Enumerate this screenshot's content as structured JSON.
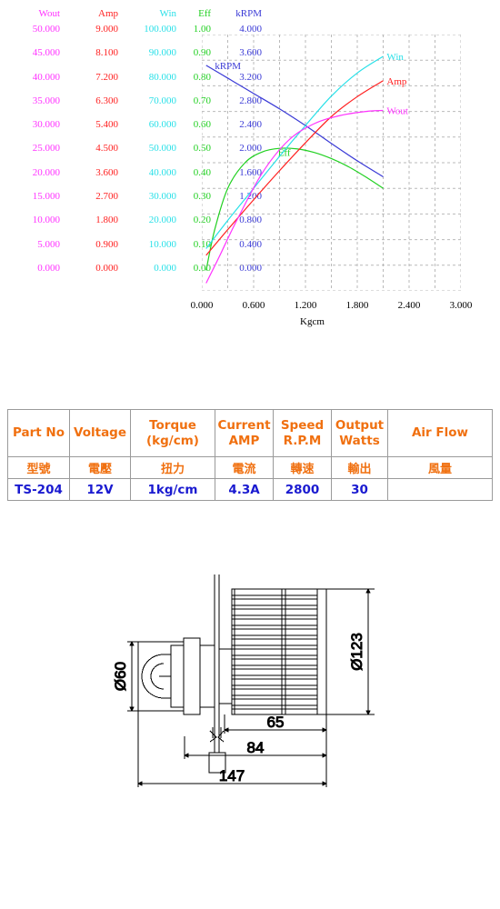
{
  "chart_data": {
    "type": "line",
    "title": "",
    "xlabel": "Kgcm",
    "ylabel": "",
    "xlim": [
      0.0,
      3.0
    ],
    "grid": true,
    "legend": "inline-labels",
    "xticks": [
      "0.000",
      "0.600",
      "1.200",
      "1.800",
      "2.400",
      "3.000"
    ],
    "axes": [
      {
        "name": "Wout",
        "color": "#ff33ff",
        "ticks": [
          "50.000",
          "45.000",
          "40.000",
          "35.000",
          "30.000",
          "25.000",
          "20.000",
          "15.000",
          "10.000",
          "5.000",
          "0.000"
        ],
        "ylim": [
          0,
          50
        ]
      },
      {
        "name": "Amp",
        "color": "#ff2020",
        "ticks": [
          "9.000",
          "8.100",
          "7.200",
          "6.300",
          "5.400",
          "4.500",
          "3.600",
          "2.700",
          "1.800",
          "0.900",
          "0.000"
        ],
        "ylim": [
          0,
          9
        ]
      },
      {
        "name": "Win",
        "color": "#29e0e8",
        "ticks": [
          "100.000",
          "90.000",
          "80.000",
          "70.000",
          "60.000",
          "50.000",
          "40.000",
          "30.000",
          "20.000",
          "10.000",
          "0.000"
        ],
        "ylim": [
          0,
          100
        ]
      },
      {
        "name": "Eff",
        "color": "#21d021",
        "ticks": [
          "1.00",
          "0.90",
          "0.80",
          "0.70",
          "0.60",
          "0.50",
          "0.40",
          "0.30",
          "0.20",
          "0.10",
          "0.00"
        ],
        "ylim": [
          0,
          1
        ]
      },
      {
        "name": "kRPM",
        "color": "#3a3ad6",
        "ticks": [
          "4.000",
          "3.600",
          "3.200",
          "2.800",
          "2.400",
          "2.000",
          "1.600",
          "1.200",
          "0.800",
          "0.400",
          "0.000"
        ],
        "ylim": [
          0,
          4
        ]
      }
    ],
    "series": [
      {
        "name": "kRPM",
        "color": "#3a3ad6",
        "unit": "kRPM",
        "label_at": {
          "x": 0.13,
          "y": 3.52
        },
        "x": [
          0.05,
          0.3,
          0.6,
          0.9,
          1.2,
          1.5,
          1.8,
          2.1
        ],
        "values": [
          3.52,
          3.32,
          3.08,
          2.84,
          2.58,
          2.3,
          2.03,
          1.78
        ]
      },
      {
        "name": "Eff",
        "color": "#21d021",
        "unit": "Eff",
        "label_at": {
          "x": 0.86,
          "y": 0.54
        },
        "x": [
          0.05,
          0.15,
          0.3,
          0.5,
          0.7,
          0.9,
          1.1,
          1.3,
          1.5,
          1.7,
          1.9,
          2.1
        ],
        "values": [
          0.08,
          0.24,
          0.4,
          0.5,
          0.542,
          0.556,
          0.554,
          0.54,
          0.516,
          0.484,
          0.444,
          0.4
        ]
      },
      {
        "name": "Win",
        "color": "#29e0e8",
        "unit": "Win",
        "label_at": {
          "x": 2.12,
          "y": 91.5
        },
        "x": [
          0.05,
          0.3,
          0.6,
          0.9,
          1.2,
          1.5,
          1.8,
          2.1
        ],
        "values": [
          16.5,
          27.5,
          40.0,
          52.5,
          64.5,
          76.0,
          85.0,
          91.5
        ]
      },
      {
        "name": "Amp",
        "color": "#ff2020",
        "unit": "Amp",
        "label_at": {
          "x": 2.12,
          "y": 7.38
        },
        "x": [
          0.05,
          0.3,
          0.6,
          0.9,
          1.2,
          1.5,
          1.8,
          2.1
        ],
        "values": [
          1.25,
          2.15,
          3.2,
          4.22,
          5.2,
          6.12,
          6.82,
          7.38
        ]
      },
      {
        "name": "Wout",
        "color": "#ff33ff",
        "unit": "Wout",
        "label_at": {
          "x": 2.12,
          "y": 35.2
        },
        "x": [
          0.05,
          0.2,
          0.4,
          0.7,
          1.0,
          1.3,
          1.6,
          1.9,
          2.1
        ],
        "values": [
          1.5,
          6.6,
          13.6,
          23.0,
          29.3,
          32.6,
          34.2,
          35.0,
          35.2
        ]
      }
    ]
  },
  "spec_table": {
    "headers_en": [
      "Part No",
      "Voltage",
      "Torque\n(kg/cm)",
      "Current\nAMP",
      "Speed\nR.P.M",
      "Output\nWatts",
      "Air  Flow"
    ],
    "headers_en_line1": [
      "Part No",
      "Voltage",
      "Torque",
      "Current",
      "Speed",
      "Output",
      "Air  Flow"
    ],
    "headers_en_line2": [
      "",
      "",
      "(kg/cm)",
      "AMP",
      "R.P.M",
      "Watts",
      ""
    ],
    "headers_cn": [
      "型號",
      "電壓",
      "扭力",
      "電流",
      "轉速",
      "輸出",
      "風量"
    ],
    "values": [
      "TS-204",
      "12V",
      "1kg/cm",
      "4.3A",
      "2800",
      "30",
      ""
    ],
    "header_color": "#f07010",
    "value_color": "#1a1ad0"
  },
  "drawing": {
    "dimensions": {
      "motor_diameter": "Ø60",
      "impeller_diameter": "Ø123",
      "impeller_width": "65",
      "body_length": "84",
      "overall_length": "147"
    }
  }
}
